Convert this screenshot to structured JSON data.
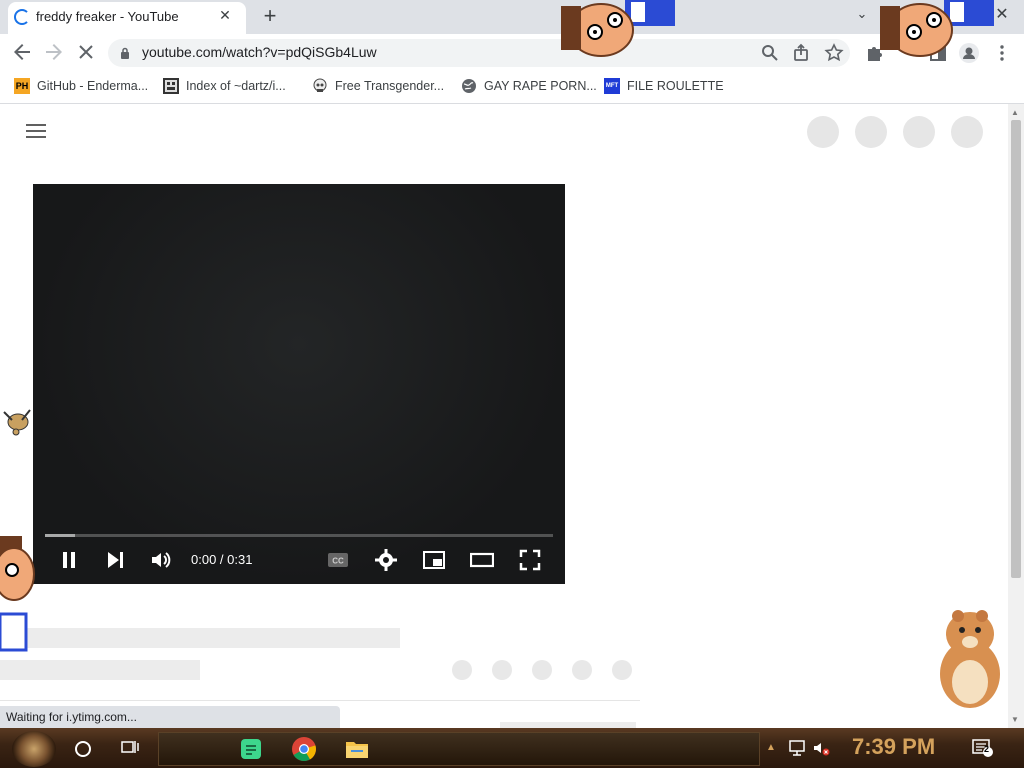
{
  "browser": {
    "tab": {
      "title": "freddy freaker - YouTube"
    },
    "address": {
      "url": "youtube.com/watch?v=pdQiSGb4Luw"
    },
    "bookmarks": [
      {
        "label": "GitHub - Enderma...",
        "icon": "ph-badge-icon",
        "icon_text": "PH"
      },
      {
        "label": "Index of ~dartz/i...",
        "icon": "folder-icon",
        "icon_text": ""
      },
      {
        "label": "Free Transgender...",
        "icon": "skull-icon",
        "icon_text": ""
      },
      {
        "label": "GAY RAPE PORN...",
        "icon": "globe-icon",
        "icon_text": ""
      },
      {
        "label": "FILE ROULETTE",
        "icon": "mft-icon",
        "icon_text": "MFT"
      }
    ]
  },
  "player": {
    "time": "0:00 / 0:31",
    "progress": 0.06
  },
  "status": {
    "text": "Waiting for i.ytimg.com..."
  },
  "taskbar": {
    "clock": "7:39 PM",
    "notification_count": "2"
  },
  "colors": {
    "accent": "#1a73e8",
    "clock": "#d4a25c",
    "taskbar": "#3a2414"
  }
}
